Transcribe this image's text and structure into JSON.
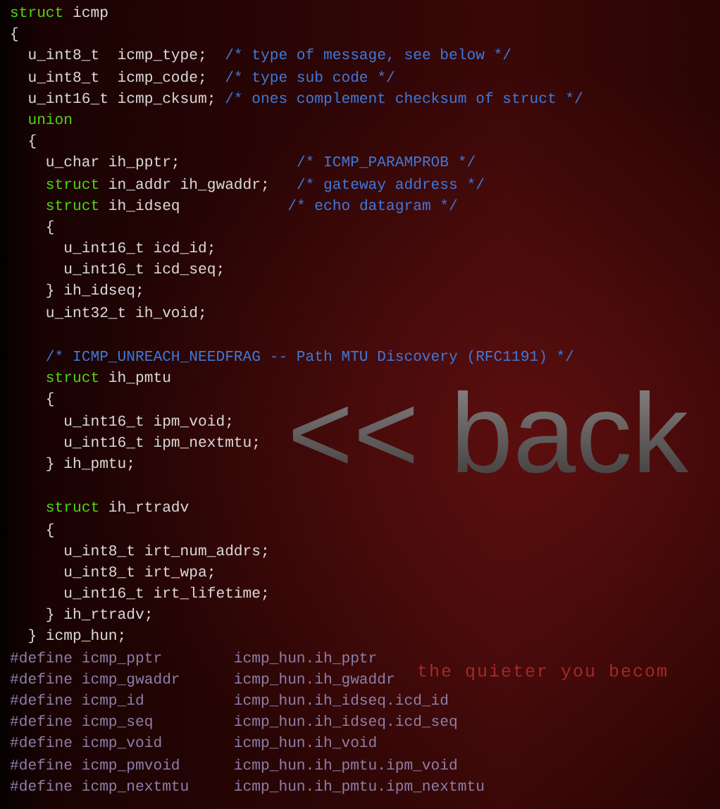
{
  "code_lines": [
    {
      "tokens": [
        {
          "kind": "keyword",
          "text": "struct"
        },
        {
          "kind": "plain",
          "text": " icmp"
        }
      ]
    },
    {
      "tokens": [
        {
          "kind": "plain",
          "text": "{"
        }
      ]
    },
    {
      "tokens": [
        {
          "kind": "plain",
          "text": "  u_int8_t  icmp_type;  "
        },
        {
          "kind": "comment",
          "text": "/* type of message, see below */"
        }
      ]
    },
    {
      "tokens": [
        {
          "kind": "plain",
          "text": "  u_int8_t  icmp_code;  "
        },
        {
          "kind": "comment",
          "text": "/* type sub code */"
        }
      ]
    },
    {
      "tokens": [
        {
          "kind": "plain",
          "text": "  u_int16_t icmp_cksum; "
        },
        {
          "kind": "comment",
          "text": "/* ones complement checksum of struct */"
        }
      ]
    },
    {
      "tokens": [
        {
          "kind": "keyword",
          "text": "  union"
        }
      ]
    },
    {
      "tokens": [
        {
          "kind": "plain",
          "text": "  {"
        }
      ]
    },
    {
      "tokens": [
        {
          "kind": "plain",
          "text": "    u_char ih_pptr;             "
        },
        {
          "kind": "comment",
          "text": "/* ICMP_PARAMPROB */"
        }
      ]
    },
    {
      "tokens": [
        {
          "kind": "keyword",
          "text": "    struct"
        },
        {
          "kind": "plain",
          "text": " in_addr ih_gwaddr;   "
        },
        {
          "kind": "comment",
          "text": "/* gateway address */"
        }
      ]
    },
    {
      "tokens": [
        {
          "kind": "keyword",
          "text": "    struct"
        },
        {
          "kind": "plain",
          "text": " ih_idseq            "
        },
        {
          "kind": "comment",
          "text": "/* echo datagram */"
        }
      ]
    },
    {
      "tokens": [
        {
          "kind": "plain",
          "text": "    {"
        }
      ]
    },
    {
      "tokens": [
        {
          "kind": "plain",
          "text": "      u_int16_t icd_id;"
        }
      ]
    },
    {
      "tokens": [
        {
          "kind": "plain",
          "text": "      u_int16_t icd_seq;"
        }
      ]
    },
    {
      "tokens": [
        {
          "kind": "plain",
          "text": "    } ih_idseq;"
        }
      ]
    },
    {
      "tokens": [
        {
          "kind": "plain",
          "text": "    u_int32_t ih_void;"
        }
      ]
    },
    {
      "gap_before": true,
      "tokens": [
        {
          "kind": "comment",
          "text": "    /* ICMP_UNREACH_NEEDFRAG -- Path MTU Discovery (RFC1191) */"
        }
      ]
    },
    {
      "tokens": [
        {
          "kind": "keyword",
          "text": "    struct"
        },
        {
          "kind": "plain",
          "text": " ih_pmtu"
        }
      ]
    },
    {
      "tokens": [
        {
          "kind": "plain",
          "text": "    {"
        }
      ]
    },
    {
      "tokens": [
        {
          "kind": "plain",
          "text": "      u_int16_t ipm_void;"
        }
      ]
    },
    {
      "tokens": [
        {
          "kind": "plain",
          "text": "      u_int16_t ipm_nextmtu;"
        }
      ]
    },
    {
      "tokens": [
        {
          "kind": "plain",
          "text": "    } ih_pmtu;"
        }
      ]
    },
    {
      "gap_before": true,
      "tokens": [
        {
          "kind": "keyword",
          "text": "    struct"
        },
        {
          "kind": "plain",
          "text": " ih_rtradv"
        }
      ]
    },
    {
      "tokens": [
        {
          "kind": "plain",
          "text": "    {"
        }
      ]
    },
    {
      "tokens": [
        {
          "kind": "plain",
          "text": "      u_int8_t irt_num_addrs;"
        }
      ]
    },
    {
      "tokens": [
        {
          "kind": "plain",
          "text": "      u_int8_t irt_wpa;"
        }
      ]
    },
    {
      "tokens": [
        {
          "kind": "plain",
          "text": "      u_int16_t irt_lifetime;"
        }
      ]
    },
    {
      "tokens": [
        {
          "kind": "plain",
          "text": "    } ih_rtradv;"
        }
      ]
    },
    {
      "tokens": [
        {
          "kind": "plain",
          "text": "  } icmp_hun;"
        }
      ]
    },
    {
      "tokens": [
        {
          "kind": "define",
          "text": "#define icmp_pptr        icmp_hun.ih_pptr"
        }
      ]
    },
    {
      "tokens": [
        {
          "kind": "define",
          "text": "#define icmp_gwaddr      icmp_hun.ih_gwaddr"
        }
      ]
    },
    {
      "tokens": [
        {
          "kind": "define",
          "text": "#define icmp_id          icmp_hun.ih_idseq.icd_id"
        }
      ]
    },
    {
      "tokens": [
        {
          "kind": "define",
          "text": "#define icmp_seq         icmp_hun.ih_idseq.icd_seq"
        }
      ]
    },
    {
      "tokens": [
        {
          "kind": "define",
          "text": "#define icmp_void        icmp_hun.ih_void"
        }
      ]
    },
    {
      "tokens": [
        {
          "kind": "define",
          "text": "#define icmp_pmvoid      icmp_hun.ih_pmtu.ipm_void"
        }
      ]
    },
    {
      "tokens": [
        {
          "kind": "define",
          "text": "#define icmp_nextmtu     icmp_hun.ih_pmtu.ipm_nextmtu"
        }
      ]
    }
  ],
  "back_link": "<< back",
  "tagline": "the quieter you becom"
}
